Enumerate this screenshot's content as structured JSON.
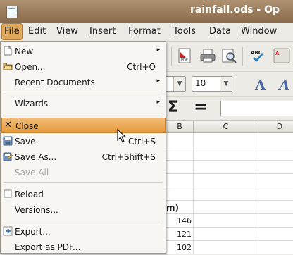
{
  "window": {
    "title": "rainfall.ods - Op"
  },
  "menubar": {
    "items": [
      "File",
      "Edit",
      "View",
      "Insert",
      "Format",
      "Tools",
      "Data",
      "Window"
    ]
  },
  "toolbar": {
    "font_size": "10",
    "sigma": "Σ",
    "equals": "="
  },
  "grid": {
    "columns": [
      "B",
      "C",
      "D"
    ],
    "partial_header": "m)",
    "values": [
      "146",
      "121",
      "102"
    ]
  },
  "file_menu": {
    "items": [
      {
        "label": "New",
        "shortcut": "",
        "submenu": true
      },
      {
        "label": "Open...",
        "shortcut": "Ctrl+O"
      },
      {
        "label": "Recent Documents",
        "shortcut": "",
        "submenu": true
      },
      {
        "label": "Wizards",
        "shortcut": "",
        "submenu": true
      },
      {
        "label": "Close",
        "shortcut": ""
      },
      {
        "label": "Save",
        "shortcut": "Ctrl+S"
      },
      {
        "label": "Save As...",
        "shortcut": "Ctrl+Shift+S"
      },
      {
        "label": "Save All",
        "shortcut": ""
      },
      {
        "label": "Reload",
        "shortcut": ""
      },
      {
        "label": "Versions...",
        "shortcut": ""
      },
      {
        "label": "Export...",
        "shortcut": ""
      },
      {
        "label": "Export as PDF...",
        "shortcut": ""
      }
    ]
  },
  "colors": {
    "menu_highlight": "#e9a24a",
    "title_bar": "#9c7d5c"
  }
}
